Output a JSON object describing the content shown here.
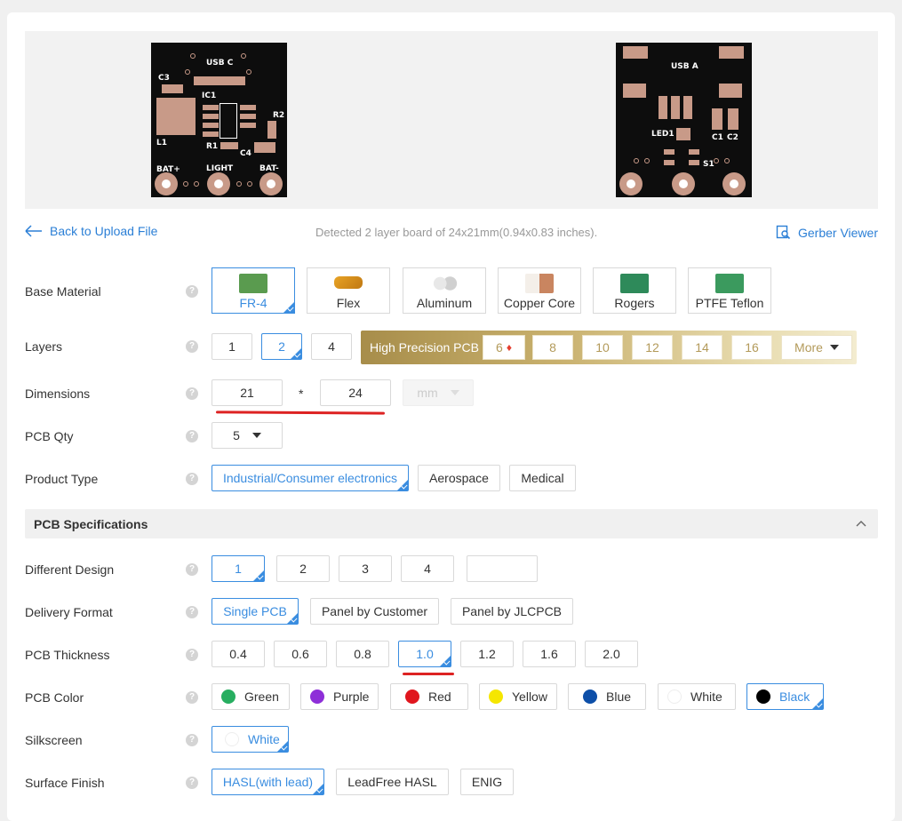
{
  "preview": {
    "left_board": {
      "labels": [
        "USB C",
        "C3",
        "IC1",
        "R2",
        "L1",
        "R1",
        "C4",
        "BAT+",
        "LIGHT",
        "BAT-"
      ]
    },
    "right_board": {
      "labels": [
        "USB A",
        "LED1",
        "C1",
        "C2",
        "S1"
      ]
    }
  },
  "nav": {
    "back_label": "Back to Upload File",
    "detected_text": "Detected 2 layer board of 24x21mm(0.94x0.83 inches).",
    "gerber_label": "Gerber Viewer"
  },
  "base_material": {
    "label": "Base Material",
    "options": [
      "FR-4",
      "Flex",
      "Aluminum",
      "Copper Core",
      "Rogers",
      "PTFE Teflon"
    ],
    "selected": "FR-4"
  },
  "layers": {
    "label": "Layers",
    "options": [
      "1",
      "2",
      "4"
    ],
    "selected": "2",
    "high_precision_label": "High Precision PCB",
    "high_precision_options": [
      "6",
      "8",
      "10",
      "12",
      "14",
      "16"
    ],
    "more_label": "More"
  },
  "dimensions": {
    "label": "Dimensions",
    "width": "21",
    "separator": "*",
    "height": "24",
    "unit": "mm"
  },
  "pcb_qty": {
    "label": "PCB Qty",
    "value": "5"
  },
  "product_type": {
    "label": "Product Type",
    "options": [
      "Industrial/Consumer electronics",
      "Aerospace",
      "Medical"
    ],
    "selected": "Industrial/Consumer electronics"
  },
  "specs_header": "PCB Specifications",
  "different_design": {
    "label": "Different Design",
    "options": [
      "1",
      "2",
      "3",
      "4",
      ""
    ],
    "selected": "1"
  },
  "delivery_format": {
    "label": "Delivery Format",
    "options": [
      "Single PCB",
      "Panel by Customer",
      "Panel by JLCPCB"
    ],
    "selected": "Single PCB"
  },
  "pcb_thickness": {
    "label": "PCB Thickness",
    "options": [
      "0.4",
      "0.6",
      "0.8",
      "1.0",
      "1.2",
      "1.6",
      "2.0"
    ],
    "selected": "1.0"
  },
  "pcb_color": {
    "label": "PCB Color",
    "options": [
      {
        "name": "Green",
        "color": "#27ae60"
      },
      {
        "name": "Purple",
        "color": "#8e2fd8"
      },
      {
        "name": "Red",
        "color": "#e0161e"
      },
      {
        "name": "Yellow",
        "color": "#f5e600"
      },
      {
        "name": "Blue",
        "color": "#0d4fa8"
      },
      {
        "name": "White",
        "color": "#ffffff"
      },
      {
        "name": "Black",
        "color": "#000000"
      }
    ],
    "selected": "Black"
  },
  "silkscreen": {
    "label": "Silkscreen",
    "value": "White"
  },
  "surface_finish": {
    "label": "Surface Finish",
    "options": [
      "HASL(with lead)",
      "LeadFree HASL",
      "ENIG"
    ],
    "selected": "HASL(with lead)"
  },
  "colors": {
    "accent": "#3a8de0",
    "gold": "#b39a5a",
    "annotation": "#dd2222"
  }
}
